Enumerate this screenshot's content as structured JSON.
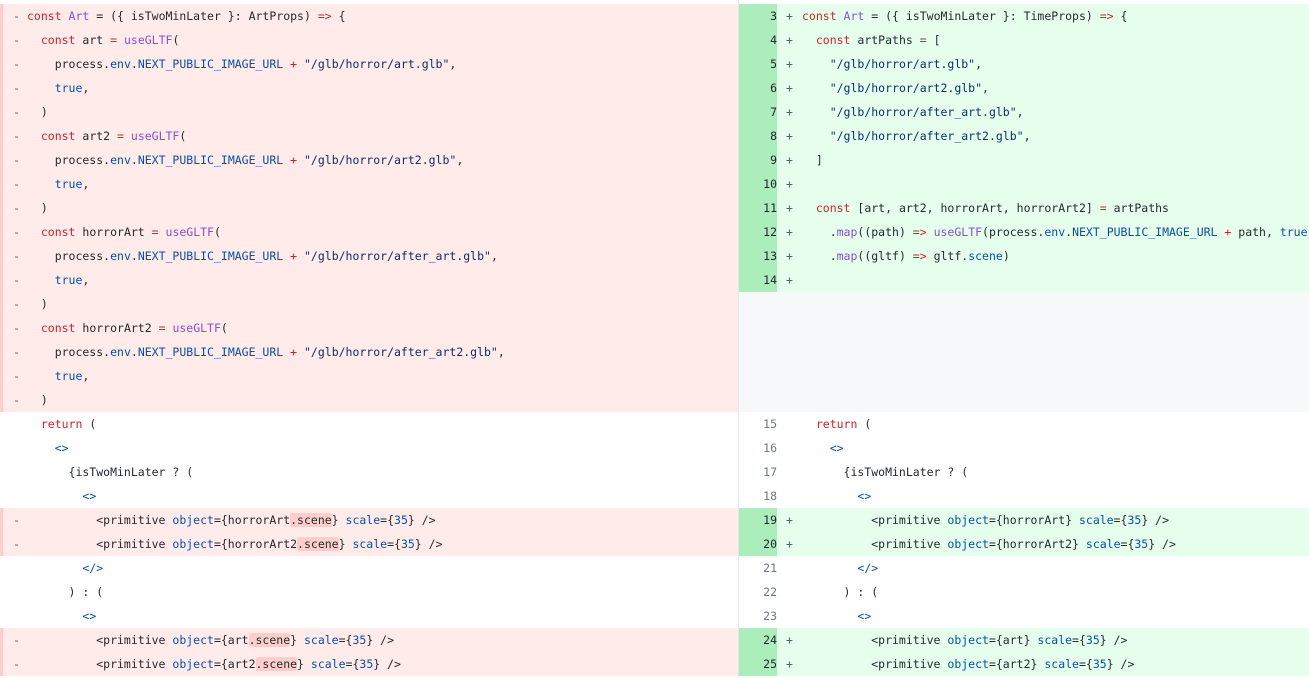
{
  "left": [
    {
      "type": "del",
      "sign": "-",
      "code": [
        {
          "t": "const ",
          "c": "kw"
        },
        {
          "t": "Art",
          "c": "fn"
        },
        {
          "t": " = ({ isTwoMinLater }: ArtProps) "
        },
        {
          "t": "=>",
          "c": "kw"
        },
        {
          "t": " {"
        }
      ]
    },
    {
      "type": "del",
      "sign": "-",
      "code": [
        {
          "t": "  "
        },
        {
          "t": "const ",
          "c": "kw"
        },
        {
          "t": "art "
        },
        {
          "t": "= ",
          "c": "kw"
        },
        {
          "t": "useGLTF",
          "c": "fn"
        },
        {
          "t": "("
        }
      ]
    },
    {
      "type": "del",
      "sign": "-",
      "code": [
        {
          "t": "    process."
        },
        {
          "t": "env",
          "c": "prop"
        },
        {
          "t": "."
        },
        {
          "t": "NEXT_PUBLIC_IMAGE_URL",
          "c": "prop"
        },
        {
          "t": " + ",
          "c": "kw"
        },
        {
          "t": "\"/glb/horror/art.glb\"",
          "c": "str"
        },
        {
          "t": ","
        }
      ]
    },
    {
      "type": "del",
      "sign": "-",
      "code": [
        {
          "t": "    "
        },
        {
          "t": "true",
          "c": "prop"
        },
        {
          "t": ","
        }
      ]
    },
    {
      "type": "del",
      "sign": "-",
      "code": [
        {
          "t": "  )"
        }
      ]
    },
    {
      "type": "del",
      "sign": "-",
      "code": [
        {
          "t": "  "
        },
        {
          "t": "const ",
          "c": "kw"
        },
        {
          "t": "art2 "
        },
        {
          "t": "= ",
          "c": "kw"
        },
        {
          "t": "useGLTF",
          "c": "fn"
        },
        {
          "t": "("
        }
      ]
    },
    {
      "type": "del",
      "sign": "-",
      "code": [
        {
          "t": "    process."
        },
        {
          "t": "env",
          "c": "prop"
        },
        {
          "t": "."
        },
        {
          "t": "NEXT_PUBLIC_IMAGE_URL",
          "c": "prop"
        },
        {
          "t": " + ",
          "c": "kw"
        },
        {
          "t": "\"/glb/horror/art2.glb\"",
          "c": "str"
        },
        {
          "t": ","
        }
      ]
    },
    {
      "type": "del",
      "sign": "-",
      "code": [
        {
          "t": "    "
        },
        {
          "t": "true",
          "c": "prop"
        },
        {
          "t": ","
        }
      ]
    },
    {
      "type": "del",
      "sign": "-",
      "code": [
        {
          "t": "  )"
        }
      ]
    },
    {
      "type": "del",
      "sign": "-",
      "code": [
        {
          "t": "  "
        },
        {
          "t": "const ",
          "c": "kw"
        },
        {
          "t": "horrorArt "
        },
        {
          "t": "= ",
          "c": "kw"
        },
        {
          "t": "useGLTF",
          "c": "fn"
        },
        {
          "t": "("
        }
      ]
    },
    {
      "type": "del",
      "sign": "-",
      "code": [
        {
          "t": "    process."
        },
        {
          "t": "env",
          "c": "prop"
        },
        {
          "t": "."
        },
        {
          "t": "NEXT_PUBLIC_IMAGE_URL",
          "c": "prop"
        },
        {
          "t": " + ",
          "c": "kw"
        },
        {
          "t": "\"/glb/horror/after_art.glb\"",
          "c": "str"
        },
        {
          "t": ","
        }
      ]
    },
    {
      "type": "del",
      "sign": "-",
      "code": [
        {
          "t": "    "
        },
        {
          "t": "true",
          "c": "prop"
        },
        {
          "t": ","
        }
      ]
    },
    {
      "type": "del",
      "sign": "-",
      "code": [
        {
          "t": "  )"
        }
      ]
    },
    {
      "type": "del",
      "sign": "-",
      "code": [
        {
          "t": "  "
        },
        {
          "t": "const ",
          "c": "kw"
        },
        {
          "t": "horrorArt2 "
        },
        {
          "t": "= ",
          "c": "kw"
        },
        {
          "t": "useGLTF",
          "c": "fn"
        },
        {
          "t": "("
        }
      ]
    },
    {
      "type": "del",
      "sign": "-",
      "code": [
        {
          "t": "    process."
        },
        {
          "t": "env",
          "c": "prop"
        },
        {
          "t": "."
        },
        {
          "t": "NEXT_PUBLIC_IMAGE_URL",
          "c": "prop"
        },
        {
          "t": " + ",
          "c": "kw"
        },
        {
          "t": "\"/glb/horror/after_art2.glb\"",
          "c": "str"
        },
        {
          "t": ","
        }
      ]
    },
    {
      "type": "del",
      "sign": "-",
      "code": [
        {
          "t": "    "
        },
        {
          "t": "true",
          "c": "prop"
        },
        {
          "t": ","
        }
      ]
    },
    {
      "type": "del",
      "sign": "-",
      "code": [
        {
          "t": "  )"
        }
      ]
    },
    {
      "type": "ctx",
      "sign": "",
      "code": [
        {
          "t": "  "
        },
        {
          "t": "return ",
          "c": "kw"
        },
        {
          "t": "("
        }
      ]
    },
    {
      "type": "ctx",
      "sign": "",
      "code": [
        {
          "t": "    "
        },
        {
          "t": "<>",
          "c": "prop"
        }
      ]
    },
    {
      "type": "ctx",
      "sign": "",
      "code": [
        {
          "t": "      {isTwoMinLater ? ("
        }
      ]
    },
    {
      "type": "ctx",
      "sign": "",
      "code": [
        {
          "t": "        "
        },
        {
          "t": "<>",
          "c": "prop"
        }
      ]
    },
    {
      "type": "del",
      "sign": "-",
      "code": [
        {
          "t": "          <primitive "
        },
        {
          "t": "object",
          "c": "prop"
        },
        {
          "t": "={horrorArt"
        },
        {
          "t": ".scene",
          "c": "hl"
        },
        {
          "t": "} "
        },
        {
          "t": "scale",
          "c": "prop"
        },
        {
          "t": "={"
        },
        {
          "t": "35",
          "c": "prop"
        },
        {
          "t": "} />"
        }
      ]
    },
    {
      "type": "del",
      "sign": "-",
      "code": [
        {
          "t": "          <primitive "
        },
        {
          "t": "object",
          "c": "prop"
        },
        {
          "t": "={horrorArt2"
        },
        {
          "t": ".scene",
          "c": "hl"
        },
        {
          "t": "} "
        },
        {
          "t": "scale",
          "c": "prop"
        },
        {
          "t": "={"
        },
        {
          "t": "35",
          "c": "prop"
        },
        {
          "t": "} />"
        }
      ]
    },
    {
      "type": "ctx",
      "sign": "",
      "code": [
        {
          "t": "        "
        },
        {
          "t": "</>",
          "c": "prop"
        }
      ]
    },
    {
      "type": "ctx",
      "sign": "",
      "code": [
        {
          "t": "      ) : ("
        }
      ]
    },
    {
      "type": "ctx",
      "sign": "",
      "code": [
        {
          "t": "        "
        },
        {
          "t": "<>",
          "c": "prop"
        }
      ]
    },
    {
      "type": "del",
      "sign": "-",
      "code": [
        {
          "t": "          <primitive "
        },
        {
          "t": "object",
          "c": "prop"
        },
        {
          "t": "={art"
        },
        {
          "t": ".scene",
          "c": "hl"
        },
        {
          "t": "} "
        },
        {
          "t": "scale",
          "c": "prop"
        },
        {
          "t": "={"
        },
        {
          "t": "35",
          "c": "prop"
        },
        {
          "t": "} />"
        }
      ]
    },
    {
      "type": "del",
      "sign": "-",
      "code": [
        {
          "t": "          <primitive "
        },
        {
          "t": "object",
          "c": "prop"
        },
        {
          "t": "={art2"
        },
        {
          "t": ".scene",
          "c": "hl"
        },
        {
          "t": "} "
        },
        {
          "t": "scale",
          "c": "prop"
        },
        {
          "t": "={"
        },
        {
          "t": "35",
          "c": "prop"
        },
        {
          "t": "} />"
        }
      ]
    }
  ],
  "right": [
    {
      "type": "add",
      "num": "3",
      "sign": "+",
      "code": [
        {
          "t": "const ",
          "c": "kw"
        },
        {
          "t": "Art",
          "c": "fn"
        },
        {
          "t": " = ({ isTwoMinLater }: TimeProps) "
        },
        {
          "t": "=>",
          "c": "kw"
        },
        {
          "t": " {"
        }
      ]
    },
    {
      "type": "add",
      "num": "4",
      "sign": "+",
      "code": [
        {
          "t": "  "
        },
        {
          "t": "const ",
          "c": "kw"
        },
        {
          "t": "artPaths "
        },
        {
          "t": "= ",
          "c": "kw"
        },
        {
          "t": "["
        }
      ]
    },
    {
      "type": "add",
      "num": "5",
      "sign": "+",
      "code": [
        {
          "t": "    "
        },
        {
          "t": "\"/glb/horror/art.glb\"",
          "c": "str"
        },
        {
          "t": ","
        }
      ]
    },
    {
      "type": "add",
      "num": "6",
      "sign": "+",
      "code": [
        {
          "t": "    "
        },
        {
          "t": "\"/glb/horror/art2.glb\"",
          "c": "str"
        },
        {
          "t": ","
        }
      ]
    },
    {
      "type": "add",
      "num": "7",
      "sign": "+",
      "code": [
        {
          "t": "    "
        },
        {
          "t": "\"/glb/horror/after_art.glb\"",
          "c": "str"
        },
        {
          "t": ","
        }
      ]
    },
    {
      "type": "add",
      "num": "8",
      "sign": "+",
      "code": [
        {
          "t": "    "
        },
        {
          "t": "\"/glb/horror/after_art2.glb\"",
          "c": "str"
        },
        {
          "t": ","
        }
      ]
    },
    {
      "type": "add",
      "num": "9",
      "sign": "+",
      "code": [
        {
          "t": "  ]"
        }
      ]
    },
    {
      "type": "add",
      "num": "10",
      "sign": "+",
      "code": []
    },
    {
      "type": "add",
      "num": "11",
      "sign": "+",
      "code": [
        {
          "t": "  "
        },
        {
          "t": "const ",
          "c": "kw"
        },
        {
          "t": "[art, art2, horrorArt, horrorArt2] "
        },
        {
          "t": "= ",
          "c": "kw"
        },
        {
          "t": "artPaths"
        }
      ]
    },
    {
      "type": "add",
      "num": "12",
      "sign": "+",
      "code": [
        {
          "t": "    ."
        },
        {
          "t": "map",
          "c": "fn"
        },
        {
          "t": "((path) "
        },
        {
          "t": "=> ",
          "c": "kw"
        },
        {
          "t": "useGLTF",
          "c": "fn"
        },
        {
          "t": "(process."
        },
        {
          "t": "env",
          "c": "prop"
        },
        {
          "t": "."
        },
        {
          "t": "NEXT_PUBLIC_IMAGE_URL",
          "c": "prop"
        },
        {
          "t": " + ",
          "c": "kw"
        },
        {
          "t": "path, "
        },
        {
          "t": "true",
          "c": "prop"
        },
        {
          "t": "))"
        }
      ]
    },
    {
      "type": "add",
      "num": "13",
      "sign": "+",
      "code": [
        {
          "t": "    ."
        },
        {
          "t": "map",
          "c": "fn"
        },
        {
          "t": "((gltf) "
        },
        {
          "t": "=> ",
          "c": "kw"
        },
        {
          "t": "gltf."
        },
        {
          "t": "scene",
          "c": "prop"
        },
        {
          "t": ")"
        }
      ]
    },
    {
      "type": "add",
      "num": "14",
      "sign": "+",
      "code": []
    },
    {
      "type": "empty",
      "num": "",
      "sign": "",
      "code": []
    },
    {
      "type": "empty",
      "num": "",
      "sign": "",
      "code": []
    },
    {
      "type": "empty",
      "num": "",
      "sign": "",
      "code": []
    },
    {
      "type": "empty",
      "num": "",
      "sign": "",
      "code": []
    },
    {
      "type": "empty",
      "num": "",
      "sign": "",
      "code": []
    },
    {
      "type": "ctx",
      "num": "15",
      "sign": "",
      "code": [
        {
          "t": "  "
        },
        {
          "t": "return ",
          "c": "kw"
        },
        {
          "t": "("
        }
      ]
    },
    {
      "type": "ctx",
      "num": "16",
      "sign": "",
      "code": [
        {
          "t": "    "
        },
        {
          "t": "<>",
          "c": "prop"
        }
      ]
    },
    {
      "type": "ctx",
      "num": "17",
      "sign": "",
      "code": [
        {
          "t": "      {isTwoMinLater ? ("
        }
      ]
    },
    {
      "type": "ctx",
      "num": "18",
      "sign": "",
      "code": [
        {
          "t": "        "
        },
        {
          "t": "<>",
          "c": "prop"
        }
      ]
    },
    {
      "type": "add",
      "num": "19",
      "sign": "+",
      "code": [
        {
          "t": "          <primitive "
        },
        {
          "t": "object",
          "c": "prop"
        },
        {
          "t": "={horrorArt} "
        },
        {
          "t": "scale",
          "c": "prop"
        },
        {
          "t": "={"
        },
        {
          "t": "35",
          "c": "prop"
        },
        {
          "t": "} />"
        }
      ]
    },
    {
      "type": "add",
      "num": "20",
      "sign": "+",
      "code": [
        {
          "t": "          <primitive "
        },
        {
          "t": "object",
          "c": "prop"
        },
        {
          "t": "={horrorArt2} "
        },
        {
          "t": "scale",
          "c": "prop"
        },
        {
          "t": "={"
        },
        {
          "t": "35",
          "c": "prop"
        },
        {
          "t": "} />"
        }
      ]
    },
    {
      "type": "ctx",
      "num": "21",
      "sign": "",
      "code": [
        {
          "t": "        "
        },
        {
          "t": "</>",
          "c": "prop"
        }
      ]
    },
    {
      "type": "ctx",
      "num": "22",
      "sign": "",
      "code": [
        {
          "t": "      ) : ("
        }
      ]
    },
    {
      "type": "ctx",
      "num": "23",
      "sign": "",
      "code": [
        {
          "t": "        "
        },
        {
          "t": "<>",
          "c": "prop"
        }
      ]
    },
    {
      "type": "add",
      "num": "24",
      "sign": "+",
      "code": [
        {
          "t": "          <primitive "
        },
        {
          "t": "object",
          "c": "prop"
        },
        {
          "t": "={art} "
        },
        {
          "t": "scale",
          "c": "prop"
        },
        {
          "t": "={"
        },
        {
          "t": "35",
          "c": "prop"
        },
        {
          "t": "} />"
        }
      ]
    },
    {
      "type": "add",
      "num": "25",
      "sign": "+",
      "code": [
        {
          "t": "          <primitive "
        },
        {
          "t": "object",
          "c": "prop"
        },
        {
          "t": "={art2} "
        },
        {
          "t": "scale",
          "c": "prop"
        },
        {
          "t": "={"
        },
        {
          "t": "35",
          "c": "prop"
        },
        {
          "t": "} />"
        }
      ]
    }
  ]
}
